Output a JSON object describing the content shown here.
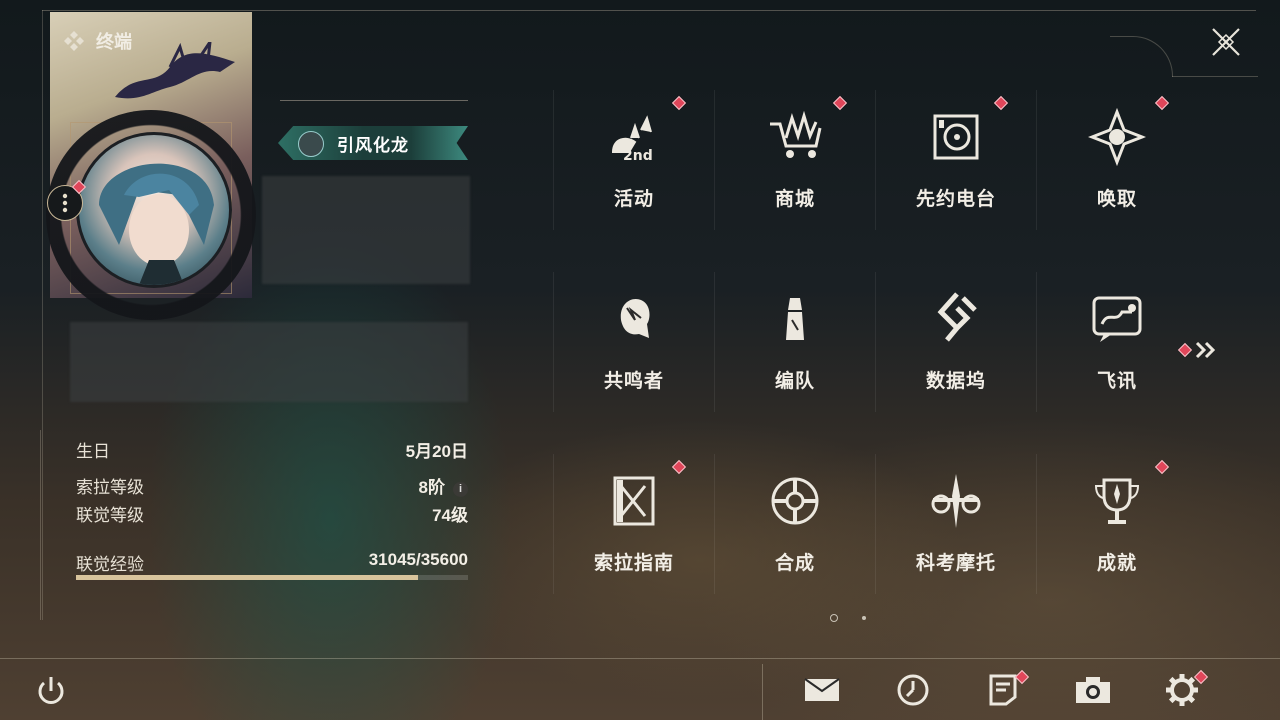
{
  "header": {
    "terminal_label": "终端"
  },
  "profile": {
    "title_badge": "引风化龙",
    "info": [
      {
        "label": "生日",
        "value": "5月20日"
      },
      {
        "label": "索拉等级",
        "value": "8阶"
      },
      {
        "label": "联觉等级",
        "value": "74级"
      }
    ],
    "exp_label": "联觉经验",
    "exp_value": "31045/35600",
    "exp_progress": 0.872
  },
  "menu": {
    "items": [
      {
        "label": "活动",
        "icon": "event-icon",
        "badge": true
      },
      {
        "label": "商城",
        "icon": "shop-cart-icon",
        "badge": true
      },
      {
        "label": "先约电台",
        "icon": "radio-icon",
        "badge": true
      },
      {
        "label": "唤取",
        "icon": "summon-icon",
        "badge": true
      },
      {
        "label": "共鸣者",
        "icon": "resonator-icon",
        "badge": false
      },
      {
        "label": "编队",
        "icon": "team-icon",
        "badge": false
      },
      {
        "label": "数据坞",
        "icon": "data-bank-icon",
        "badge": false
      },
      {
        "label": "飞讯",
        "icon": "message-icon",
        "badge": false
      },
      {
        "label": "索拉指南",
        "icon": "guide-icon",
        "badge": true
      },
      {
        "label": "合成",
        "icon": "synthesis-icon",
        "badge": false
      },
      {
        "label": "科考摩托",
        "icon": "motorbike-icon",
        "badge": false
      },
      {
        "label": "成就",
        "icon": "trophy-icon",
        "badge": true
      }
    ],
    "page_current": 1,
    "page_count": 2
  },
  "footer": {
    "buttons": [
      {
        "icon": "mail-icon",
        "badge": false
      },
      {
        "icon": "clock-icon",
        "badge": false
      },
      {
        "icon": "notice-icon",
        "badge": true
      },
      {
        "icon": "camera-icon",
        "badge": false
      },
      {
        "icon": "settings-gear-icon",
        "badge": true
      }
    ]
  },
  "colors": {
    "badge": "#e0465a",
    "accent_gold": "#d8c49c",
    "badge_teal": "#2e6f64"
  }
}
